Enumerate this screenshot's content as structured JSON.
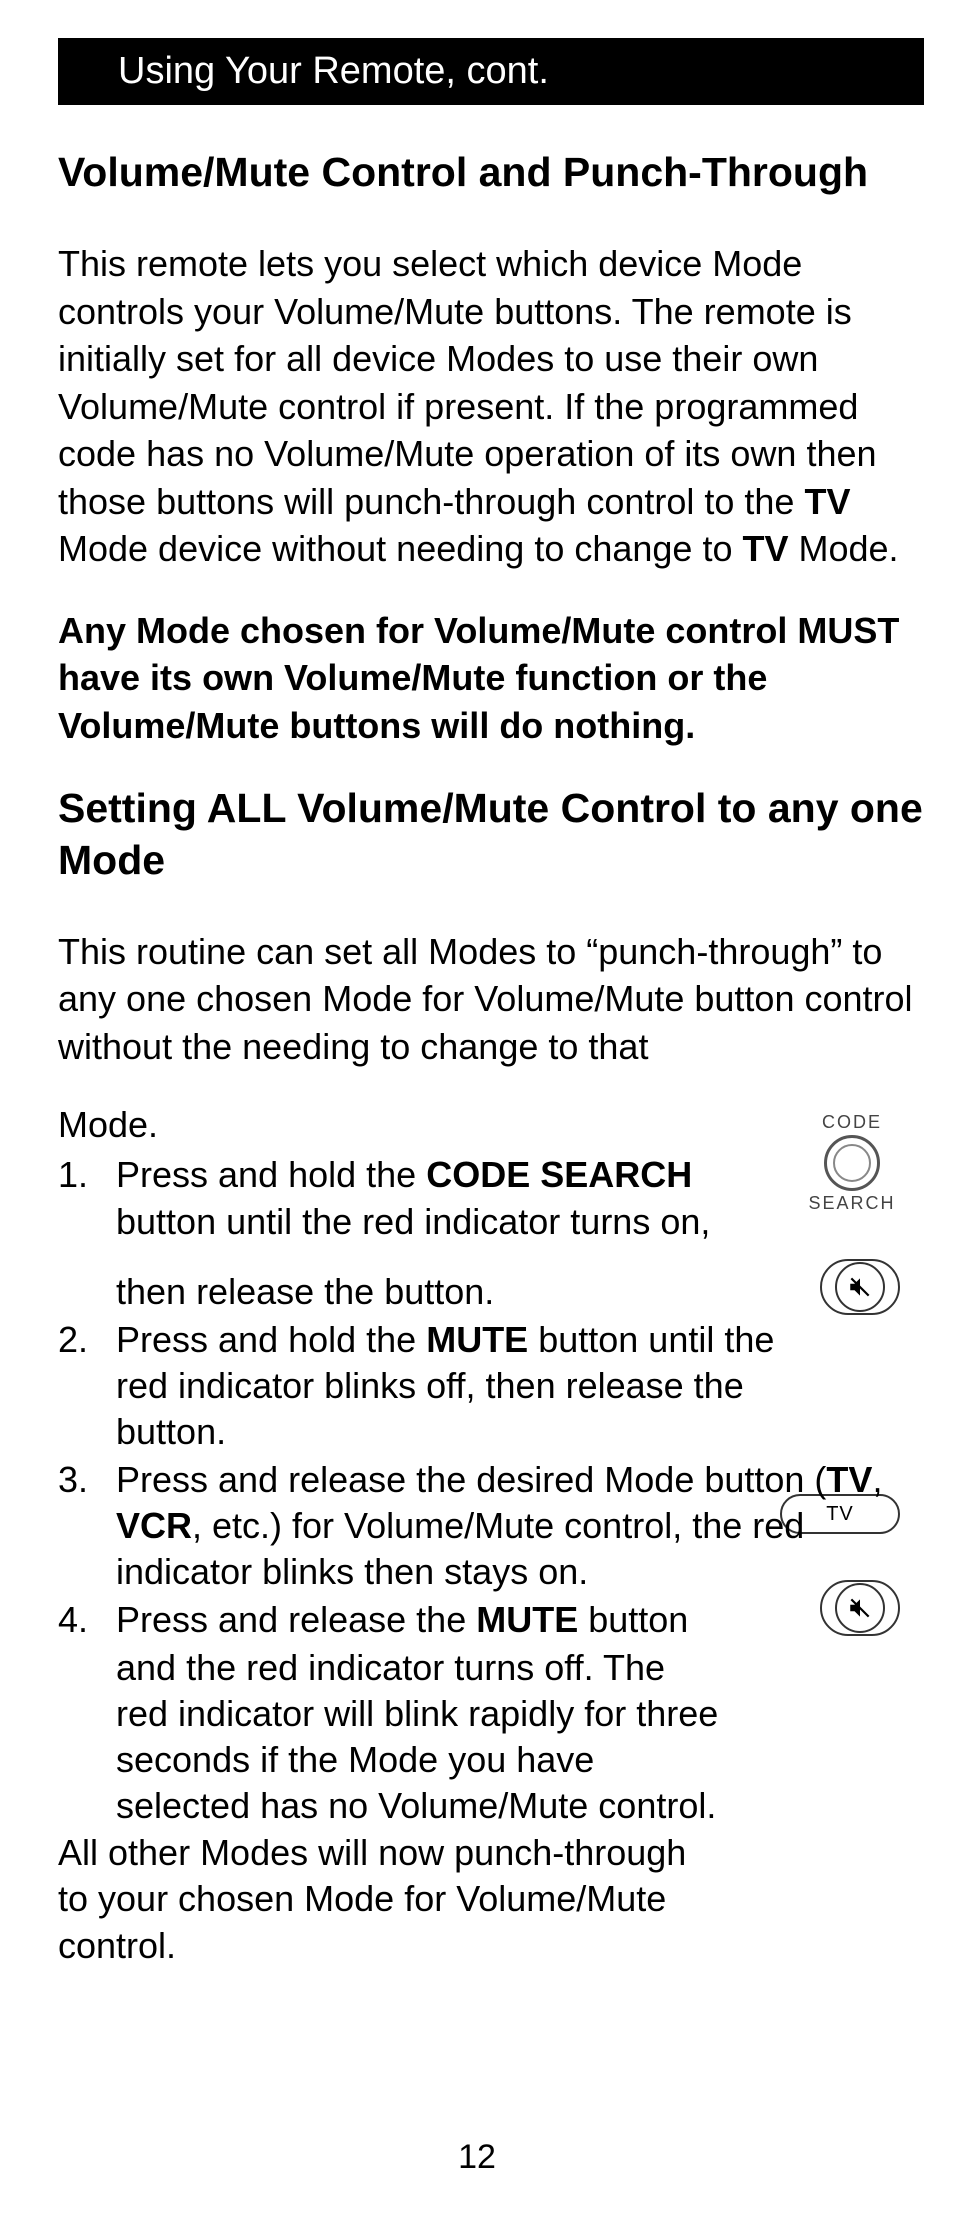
{
  "header": "Using Your Remote, cont.",
  "section1": {
    "title": "Volume/Mute Control and Punch-Through",
    "para1_a": "This remote lets you select which device Mode controls your Volume/Mute buttons. The remote is initially set for all device Modes to use their own Volume/Mute control if present. If the programmed code has no Volume/Mute operation of its own then those buttons will punch-through control to the ",
    "para1_tv1": "TV",
    "para1_b": " Mode device without needing to change to ",
    "para1_tv2": "TV",
    "para1_c": " Mode.",
    "para2": "Any Mode chosen for Volume/Mute control MUST have its own Volume/Mute function or the Volume/Mute buttons will do nothing."
  },
  "section2": {
    "title": "Setting ALL Volume/Mute Control to any one Mode",
    "intro": "This routine can set all Modes to “punch-through” to any one chosen Mode for Volume/Mute button control without the needing to change to that",
    "mode_word": "Mode.",
    "steps": {
      "s1a_a": "Press and hold the ",
      "s1a_b": "CODE SEARCH",
      "s1a_c": " button until the red indicator turns on,",
      "s1b": "then release the button.",
      "s2_a": "Press and hold the ",
      "s2_b": "MUTE",
      "s2_c": " button until the red indicator blinks off, then release the button.",
      "s3_a": "Press and release the desired Mode button (",
      "s3_b": "TV",
      "s3_c": ", ",
      "s3_d": "VCR",
      "s3_e": ", etc.) for Volume/Mute control, the red indicator blinks then stays on.",
      "s4a_a": "Press and release the ",
      "s4a_b": "MUTE",
      "s4a_c": " button",
      "s4b": "and the red indicator turns off. The red indicator will blink rapidly for three seconds if the Mode you have selected has no Volume/Mute control."
    },
    "conclusion": "All other Modes will now punch-through to your chosen Mode for Volume/Mute control."
  },
  "icons": {
    "code_top": "CODE",
    "code_bot": "SEARCH",
    "tv": "TV"
  },
  "page_number": "12"
}
